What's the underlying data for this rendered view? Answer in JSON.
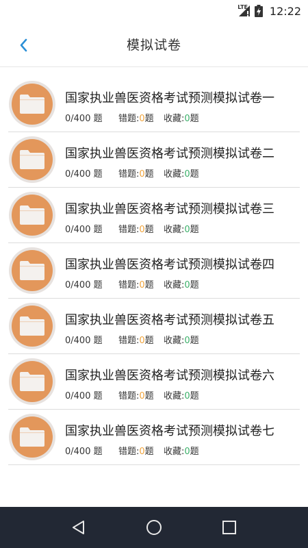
{
  "status_bar": {
    "network": "LTE",
    "time": "12:22"
  },
  "header": {
    "title": "模拟试卷",
    "back_icon": "chevron-left-icon",
    "accent_color": "#2b8fd6"
  },
  "papers": [
    {
      "title": "国家执业兽医资格考试预测模拟试卷一",
      "progress": "0/400 题",
      "wrong_label": "错题:",
      "wrong_count": "0",
      "wrong_unit": "题",
      "fav_label": "收藏:",
      "fav_count": "0",
      "fav_unit": "题"
    },
    {
      "title": "国家执业兽医资格考试预测模拟试卷二",
      "progress": "0/400 题",
      "wrong_label": "错题:",
      "wrong_count": "0",
      "wrong_unit": "题",
      "fav_label": "收藏:",
      "fav_count": "0",
      "fav_unit": "题"
    },
    {
      "title": "国家执业兽医资格考试预测模拟试卷三",
      "progress": "0/400 题",
      "wrong_label": "错题:",
      "wrong_count": "0",
      "wrong_unit": "题",
      "fav_label": "收藏:",
      "fav_count": "0",
      "fav_unit": "题"
    },
    {
      "title": "国家执业兽医资格考试预测模拟试卷四",
      "progress": "0/400 题",
      "wrong_label": "错题:",
      "wrong_count": "0",
      "wrong_unit": "题",
      "fav_label": "收藏:",
      "fav_count": "0",
      "fav_unit": "题"
    },
    {
      "title": "国家执业兽医资格考试预测模拟试卷五",
      "progress": "0/400 题",
      "wrong_label": "错题:",
      "wrong_count": "0",
      "wrong_unit": "题",
      "fav_label": "收藏:",
      "fav_count": "0",
      "fav_unit": "题"
    },
    {
      "title": "国家执业兽医资格考试预测模拟试卷六",
      "progress": "0/400 题",
      "wrong_label": "错题:",
      "wrong_count": "0",
      "wrong_unit": "题",
      "fav_label": "收藏:",
      "fav_count": "0",
      "fav_unit": "题"
    },
    {
      "title": "国家执业兽医资格考试预测模拟试卷七",
      "progress": "0/400 题",
      "wrong_label": "错题:",
      "wrong_count": "0",
      "wrong_unit": "题",
      "fav_label": "收藏:",
      "fav_count": "0",
      "fav_unit": "题"
    }
  ],
  "colors": {
    "avatar_fill": "#e3975b",
    "wrong_count": "#f0a43c",
    "fav_count": "#3cb06a",
    "nav_bar": "#222834"
  },
  "nav": {
    "back_icon": "triangle-back-icon",
    "home_icon": "circle-home-icon",
    "recents_icon": "square-recents-icon"
  }
}
